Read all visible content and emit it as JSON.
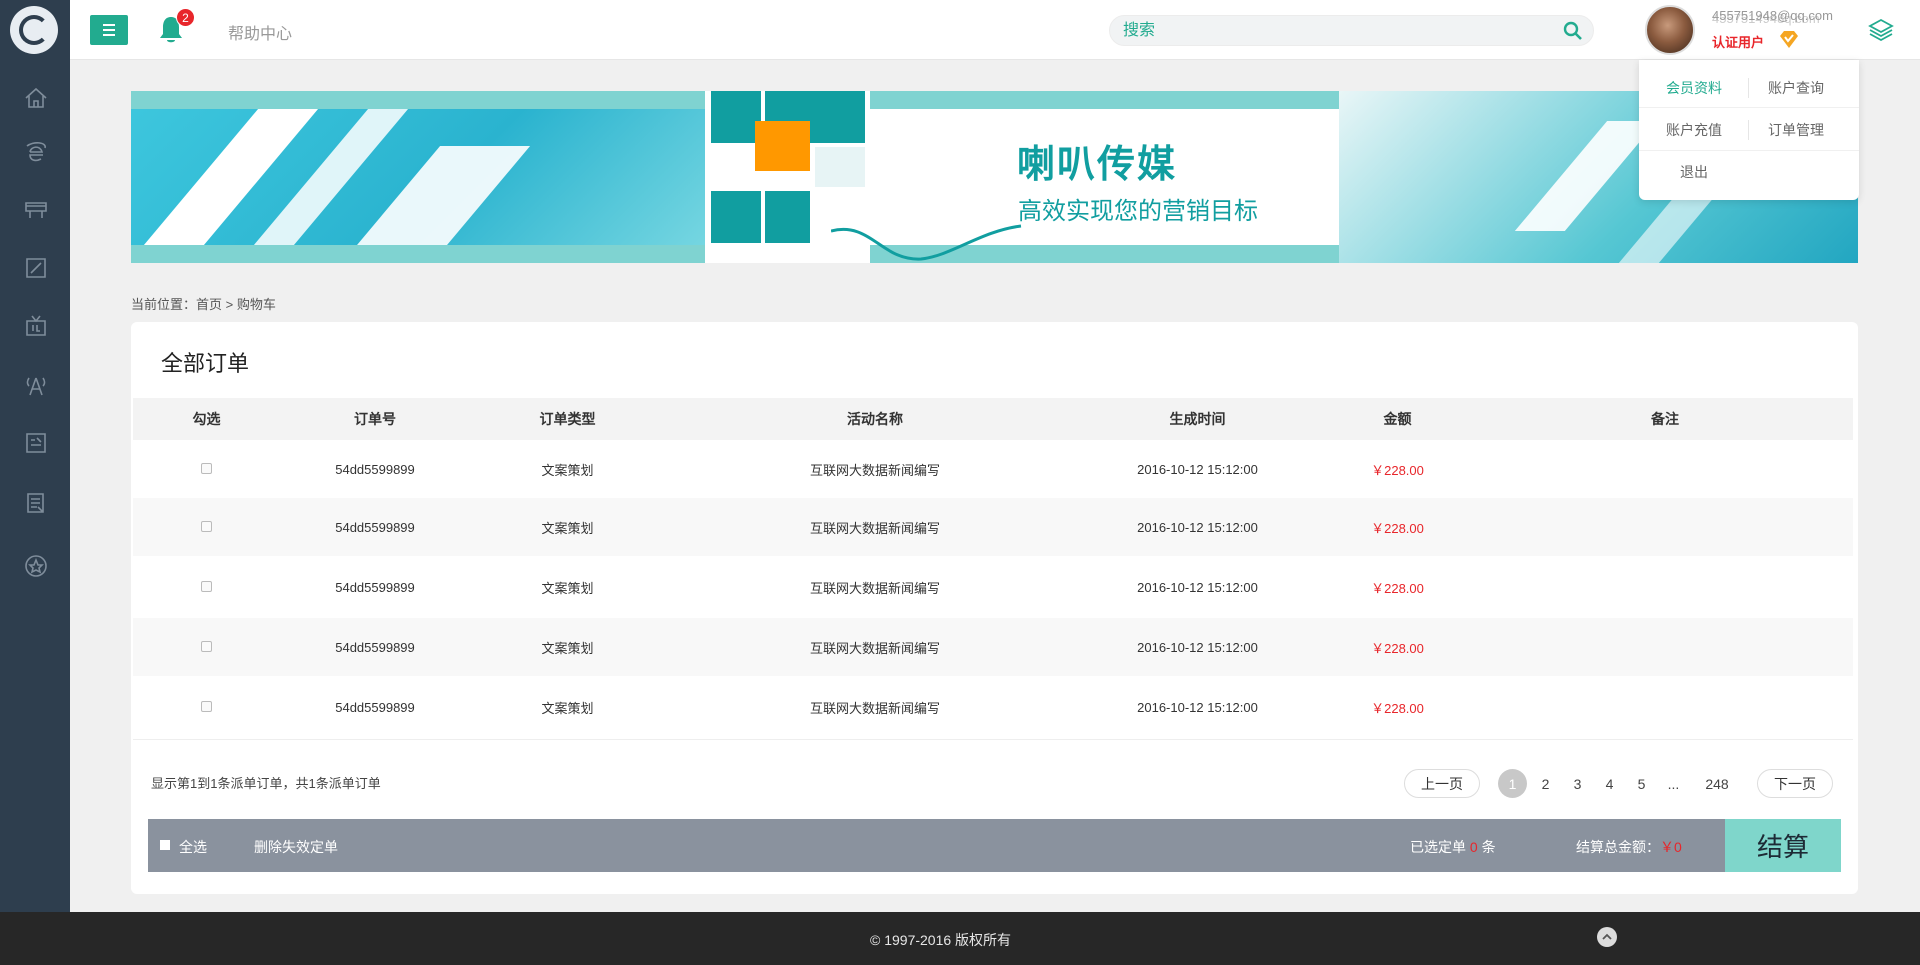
{
  "topbar": {
    "help_label": "帮助中心",
    "notification_count": "2",
    "search_placeholder": "搜索",
    "user_email": "455751948@qq.com",
    "user_email_ghost": "4557514948q.com",
    "verified_label": "认证用户"
  },
  "user_menu": {
    "items": [
      "会员资料",
      "账户查询",
      "账户充值",
      "订单管理",
      "退出"
    ]
  },
  "banner": {
    "title": "喇叭传媒",
    "subtitle": "高效实现您的营销目标"
  },
  "breadcrumb": "当前位置：首页 > 购物车",
  "panel": {
    "title": "全部订单",
    "columns": [
      "勾选",
      "订单号",
      "订单类型",
      "活动名称",
      "生成时间",
      "金额",
      "备注"
    ],
    "rows": [
      {
        "order_no": "54dd5599899",
        "type": "文案策划",
        "activity": "互联网大数据新闻编写",
        "time": "2016-10-12 15:12:00",
        "amount": "￥228.00",
        "note": ""
      },
      {
        "order_no": "54dd5599899",
        "type": "文案策划",
        "activity": "互联网大数据新闻编写",
        "time": "2016-10-12 15:12:00",
        "amount": "￥228.00",
        "note": ""
      },
      {
        "order_no": "54dd5599899",
        "type": "文案策划",
        "activity": "互联网大数据新闻编写",
        "time": "2016-10-12 15:12:00",
        "amount": "￥228.00",
        "note": ""
      },
      {
        "order_no": "54dd5599899",
        "type": "文案策划",
        "activity": "互联网大数据新闻编写",
        "time": "2016-10-12 15:12:00",
        "amount": "￥228.00",
        "note": ""
      },
      {
        "order_no": "54dd5599899",
        "type": "文案策划",
        "activity": "互联网大数据新闻编写",
        "time": "2016-10-12 15:12:00",
        "amount": "￥228.00",
        "note": ""
      }
    ],
    "summary": "显示第1到1条派单订单，共1条派单订单"
  },
  "pagination": {
    "prev": "上一页",
    "pages": [
      "1",
      "2",
      "3",
      "4",
      "5",
      "...",
      "248"
    ],
    "next": "下一页",
    "current": "1"
  },
  "actionbar": {
    "select_all": "全选",
    "delete_invalid": "删除失效定单",
    "selected_prefix": "已选定单",
    "selected_count": "0",
    "selected_suffix": "条",
    "total_label": "结算总金额：",
    "total_value": "￥0",
    "checkout": "结算"
  },
  "footer": {
    "copyright": "© 1997-2016 版权所有"
  },
  "sidebar": {
    "icons": [
      "home-icon",
      "browser-icon",
      "billboard-icon",
      "edit-icon",
      "tv-icon",
      "tower-icon",
      "media-icon",
      "document-icon",
      "star-icon"
    ]
  },
  "colors": {
    "accent": "#22ab8f",
    "sidebar": "#2e3e4e",
    "price": "#e8262b",
    "checkout": "#7fd6cb"
  }
}
